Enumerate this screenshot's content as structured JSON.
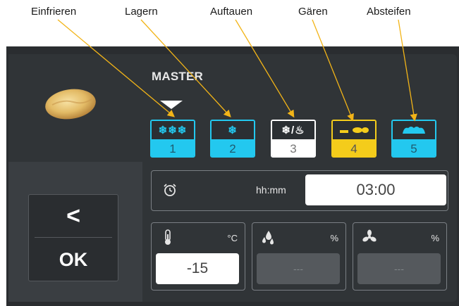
{
  "annotations": [
    "Einfrieren",
    "Lagern",
    "Auftauen",
    "Gären",
    "Absteifen"
  ],
  "master_label": "MASTER",
  "programs": [
    {
      "icon": "❄❄❄",
      "icon_name": "triple-snowflake-icon",
      "number": "1",
      "style": "cyan"
    },
    {
      "icon": "❄",
      "icon_name": "snowflake-icon",
      "number": "2",
      "style": "cyan"
    },
    {
      "icon": "❄/♨",
      "icon_name": "thaw-icon",
      "number": "3",
      "style": "white"
    },
    {
      "icon": "▬◆",
      "icon_name": "proofing-icon",
      "number": "4",
      "style": "yellow"
    },
    {
      "icon": "▲",
      "icon_name": "bake-off-icon",
      "number": "5",
      "style": "cyan"
    }
  ],
  "timer": {
    "unit": "hh:mm",
    "value": "03:00"
  },
  "nav": {
    "back": "<",
    "ok": "OK"
  },
  "params": [
    {
      "icon_name": "thermometer-icon",
      "unit": "°C",
      "value": "-15"
    },
    {
      "icon_name": "humidity-drops-icon",
      "unit": "%",
      "value": "---"
    },
    {
      "icon_name": "fan-icon",
      "unit": "%",
      "value": "---"
    }
  ],
  "colors": {
    "cyan": "#23c8ef",
    "yellow": "#f4cc1b",
    "panel": "#303437",
    "annotation_arrow": "#f2b418"
  }
}
